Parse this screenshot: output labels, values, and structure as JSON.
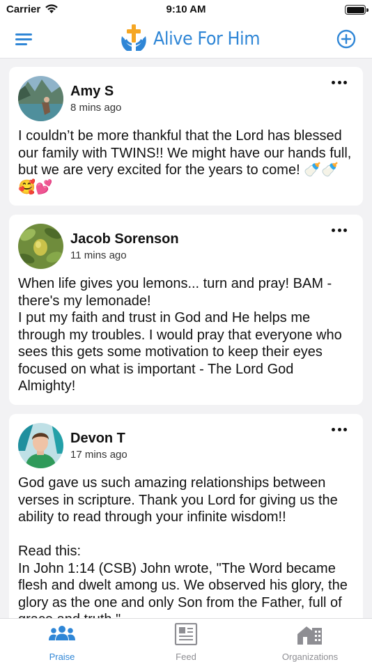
{
  "status_bar": {
    "carrier": "Carrier",
    "time": "9:10 AM",
    "battery_level": 1.0
  },
  "nav": {
    "app_name": "Alive For Him",
    "menu_icon": "hamburger-menu-icon",
    "add_icon": "plus-circle-icon",
    "accent_color": "#2f86d6",
    "logo_cross_color": "#f5a623"
  },
  "posts": [
    {
      "author": "Amy S",
      "time": "8 mins ago",
      "body": "I couldn’t be more thankful that the Lord has blessed our family with TWINS!! We might have our hands full, but we are very excited for the years to come! 🍼🍼🥰💕"
    },
    {
      "author": "Jacob Sorenson",
      "time": "11 mins ago",
      "body": "When life gives you lemons... turn and pray! BAM - there's my lemonade!\nI put my faith and trust in God and He helps me through my troubles. I would pray that everyone who sees this gets some motivation to keep their eyes focused on what is important - The Lord God Almighty!"
    },
    {
      "author": "Devon T",
      "time": "17 mins ago",
      "body": "God gave us such amazing relationships between verses in scripture. Thank you Lord for giving us the ability to read through your infinite wisdom!!\n\nRead this:\nIn John 1:14 (CSB) John wrote, \"The Word became flesh and dwelt among us. We observed his glory, the glory as the one and only Son from the Father, full of grace and truth.\""
    }
  ],
  "tabs": [
    {
      "label": "Praise",
      "icon": "people-group-icon",
      "active": true
    },
    {
      "label": "Feed",
      "icon": "newspaper-icon",
      "active": false
    },
    {
      "label": "Organizations",
      "icon": "building-icon",
      "active": false
    }
  ]
}
